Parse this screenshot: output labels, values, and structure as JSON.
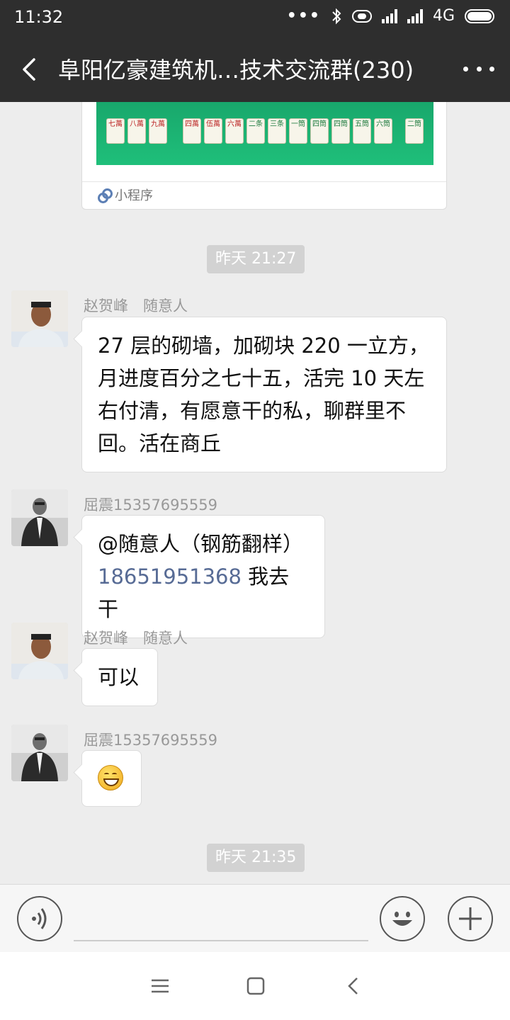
{
  "status_bar": {
    "time": "11:32",
    "network": "4G",
    "icons": [
      "more-dots-icon",
      "bluetooth-icon",
      "eye-comfort-icon",
      "signal-icon",
      "signal-icon",
      "battery-icon"
    ]
  },
  "header": {
    "back_icon": "chevron-left-icon",
    "title": "阜阳亿豪建筑机…技术交流群(230)",
    "more_icon": "more-dots-icon"
  },
  "mini_program_card": {
    "label": "小程序",
    "tiles": [
      "七萬",
      "八萬",
      "九萬",
      "四萬",
      "伍萬",
      "六萬",
      "二条",
      "三条",
      "一筒",
      "四筒",
      "四筒",
      "五筒",
      "六筒",
      "二筒"
    ]
  },
  "messages": [
    {
      "type": "time",
      "text": "昨天 21:27"
    },
    {
      "type": "msg",
      "sender": "赵贺峰　随意人",
      "text": "27 层的砌墙，加砌块 220 一立方，月进度百分之七十五，活完 10 天左右付清，有愿意干的私，聊群里不回。活在商丘",
      "lines": [
        "27 层的砌墙，加砌块 220 一立方，",
        "月进度百分之七十五，活完 10 天左",
        "右付清，有愿意干的私，聊群里不",
        "回。活在商丘"
      ]
    },
    {
      "type": "msg",
      "sender": "屈震15357695559",
      "mention": "@随意人（钢筋翻样）",
      "phone": "18651951368",
      "tail": " 我去干"
    },
    {
      "type": "msg",
      "sender": "赵贺峰　随意人",
      "text": "可以"
    },
    {
      "type": "msg",
      "sender": "屈震15357695559",
      "emoji": "grin-emoji"
    },
    {
      "type": "time",
      "text": "昨天 21:35"
    }
  ],
  "input_bar": {
    "voice_icon": "voice-icon",
    "emoji_icon": "smiley-icon",
    "plus_icon": "plus-icon"
  },
  "nav_bar": {
    "menu_icon": "menu-icon",
    "home_icon": "home-square-icon",
    "back_icon": "back-chevron-icon"
  }
}
